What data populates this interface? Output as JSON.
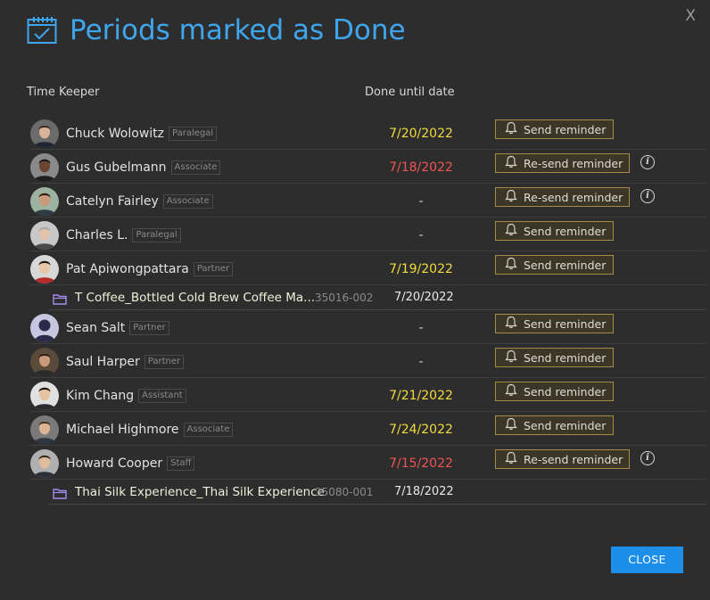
{
  "dialog": {
    "title": "Periods marked as Done",
    "close_x": "X",
    "close_button": "CLOSE"
  },
  "columns": {
    "time_keeper": "Time Keeper",
    "done_until": "Done until date"
  },
  "colors": {
    "accent": "#3fa6ee",
    "date_ok": "#f2dc3d",
    "date_overdue": "#f05454",
    "button_border": "#a78a45",
    "close_button": "#1e8fe8"
  },
  "rows": [
    {
      "type": "person",
      "name": "Chuck Wolowitz",
      "role": "Paralegal",
      "date": "7/20/2022",
      "date_style": "yellow",
      "button": "Send reminder",
      "button_kind": "send",
      "info": false,
      "avatar": "man-dark-suit"
    },
    {
      "type": "person",
      "name": "Gus Gubelmann",
      "role": "Associate",
      "date": "7/18/2022",
      "date_style": "red",
      "button": "Re-send reminder",
      "button_kind": "resend",
      "info": true,
      "avatar": "man-black"
    },
    {
      "type": "person",
      "name": "Catelyn Fairley",
      "role": "Associate",
      "date": "-",
      "date_style": "dash",
      "button": "Re-send reminder",
      "button_kind": "resend",
      "info": true,
      "avatar": "woman-dark-hair"
    },
    {
      "type": "person",
      "name": "Charles L.",
      "role": "Paralegal",
      "date": "-",
      "date_style": "dash",
      "button": "Send reminder",
      "button_kind": "send",
      "info": false,
      "avatar": "older-woman"
    },
    {
      "type": "person",
      "name": "Pat Apiwongpattara",
      "role": "Partner",
      "date": "7/19/2022",
      "date_style": "yellow",
      "button": "Send reminder",
      "button_kind": "send",
      "info": false,
      "avatar": "woman-asian"
    },
    {
      "type": "matter",
      "name": "T Coffee_Bottled Cold Brew Coffee Ma...",
      "code": "35016-002",
      "date": "7/20/2022"
    },
    {
      "type": "person",
      "name": "Sean Salt",
      "role": "Partner",
      "date": "-",
      "date_style": "dash",
      "button": "Send reminder",
      "button_kind": "send",
      "info": false,
      "avatar": "placeholder"
    },
    {
      "type": "person",
      "name": "Saul Harper",
      "role": "Partner",
      "date": "-",
      "date_style": "dash",
      "button": "Send reminder",
      "button_kind": "send",
      "info": false,
      "avatar": "man-brown"
    },
    {
      "type": "person",
      "name": "Kim Chang",
      "role": "Assistant",
      "date": "7/21/2022",
      "date_style": "yellow",
      "button": "Send reminder",
      "button_kind": "send",
      "info": false,
      "avatar": "woman-asian-2"
    },
    {
      "type": "person",
      "name": "Michael Highmore",
      "role": "Associate",
      "date": "7/24/2022",
      "date_style": "yellow",
      "button": "Send reminder",
      "button_kind": "send",
      "info": false,
      "avatar": "man-smiling"
    },
    {
      "type": "person",
      "name": "Howard Cooper",
      "role": "Staff",
      "date": "7/15/2022",
      "date_style": "red",
      "button": "Re-send reminder",
      "button_kind": "resend",
      "info": true,
      "avatar": "man-young"
    },
    {
      "type": "matter",
      "name": "Thai Silk Experience_Thai Silk Experience",
      "code": "35080-001",
      "date": "7/18/2022"
    }
  ]
}
